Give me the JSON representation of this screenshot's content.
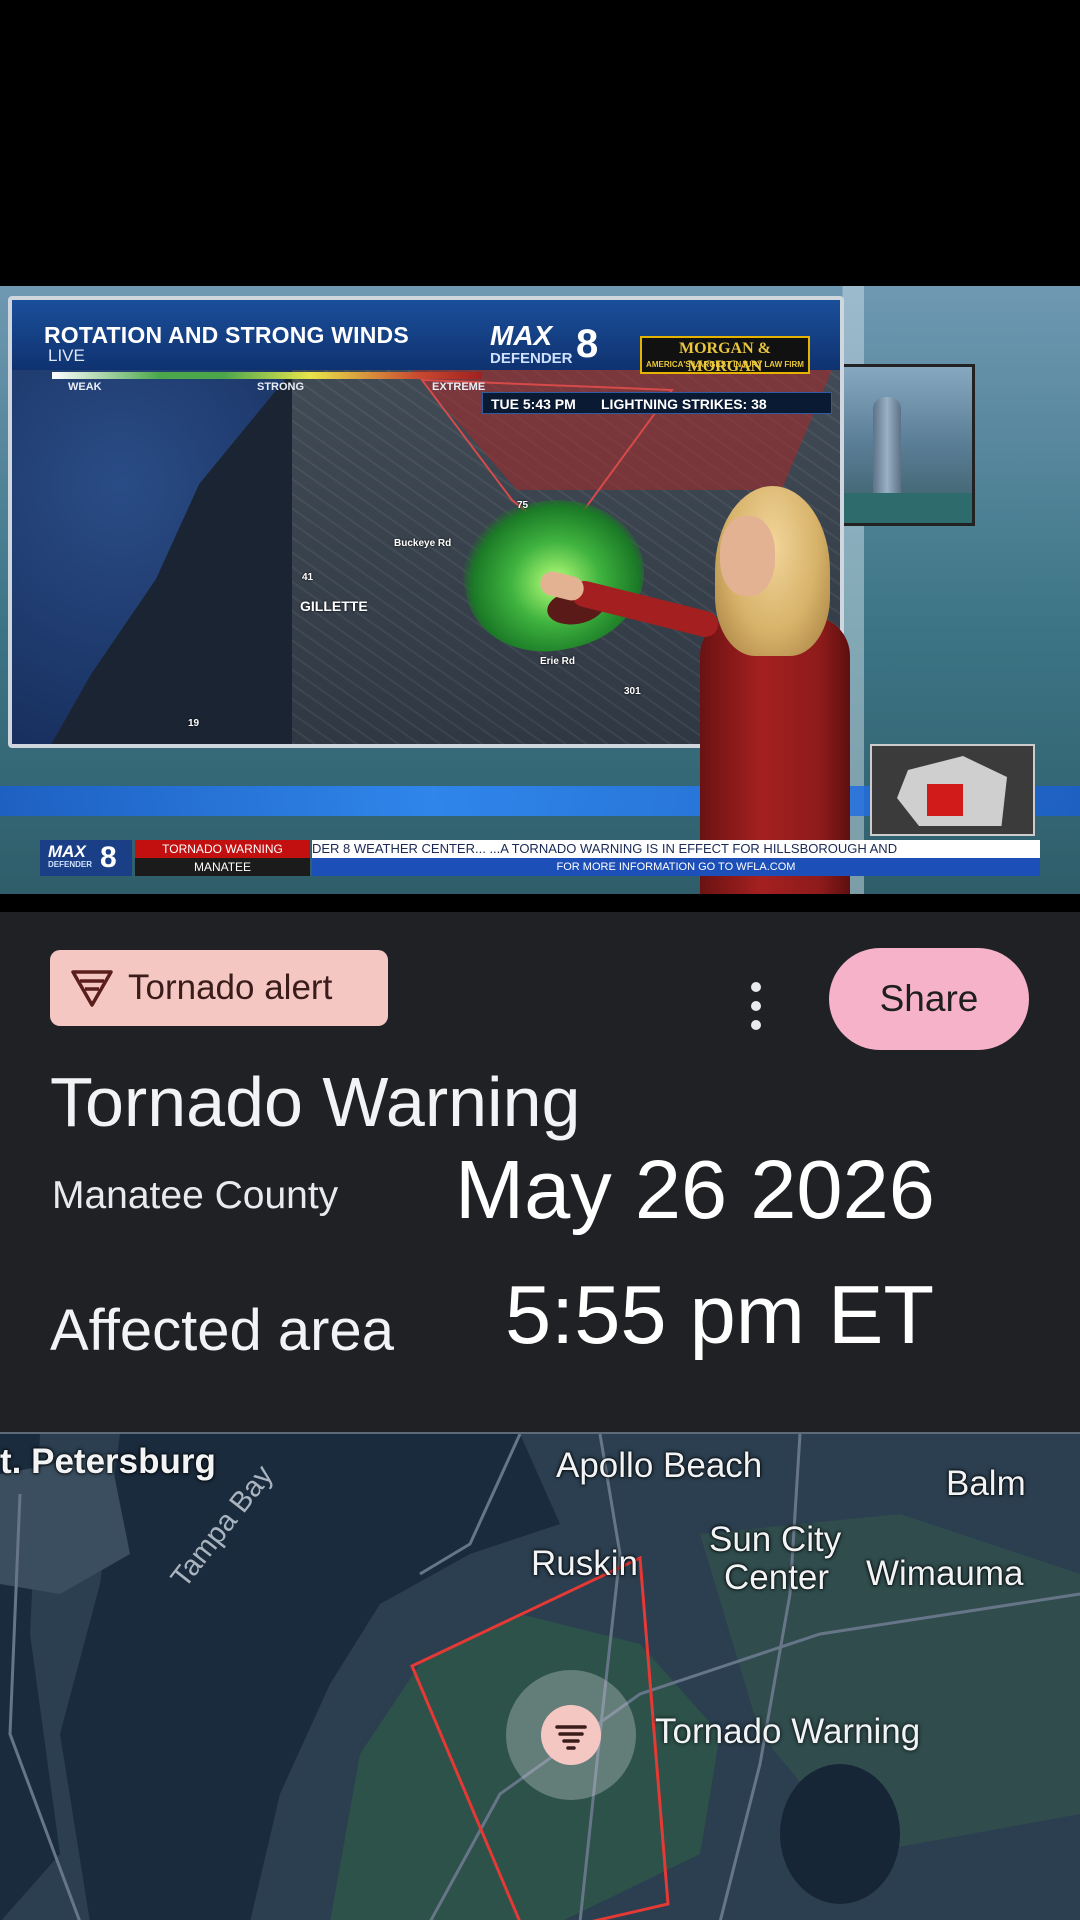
{
  "broadcast": {
    "title": "ROTATION AND STRONG WINDS",
    "live": "LIVE",
    "logo_max": "MAX",
    "logo_defender": "DEFENDER",
    "logo_number": "8",
    "sponsor_name": "MORGAN & MORGAN",
    "sponsor_tagline": "AMERICA'S LARGEST INJURY LAW FIRM",
    "scale_weak": "WEAK",
    "scale_strong": "STRONG",
    "scale_extreme": "EXTREME",
    "time": "TUE 5:43 PM",
    "lightning": "LIGHTNING STRIKES: 38",
    "map_labels": {
      "gillette": "GILLETTE",
      "buckeye": "Buckeye Rd",
      "erie": "Erie Rd",
      "route41": "41",
      "route19": "19",
      "route301": "301",
      "route75": "75"
    },
    "lower_third": {
      "logo_max": "MAX",
      "logo_defender": "DEFENDER",
      "logo_number": "8",
      "warning_top": "TORNADO WARNING",
      "warning_bottom": "MANATEE",
      "ticker": "DER 8 WEATHER CENTER...   ...A TORNADO WARNING IS IN EFFECT FOR HILLSBOROUGH AND",
      "info": "FOR MORE INFORMATION GO TO WFLA.COM"
    }
  },
  "alert": {
    "chip_label": "Tornado alert",
    "share_label": "Share",
    "title": "Tornado Warning",
    "county": "Manatee County",
    "date_overlay": "May 26 2026",
    "affected_label": "Affected area",
    "time_overlay": "5:55 pm ET"
  },
  "map": {
    "cities": {
      "st_petersburg": "t. Petersburg",
      "apollo_beach": "Apollo Beach",
      "balm": "Balm",
      "ruskin": "Ruskin",
      "sun_city_1": "Sun City",
      "sun_city_2": "Center",
      "wimauma": "Wimauma"
    },
    "bay_label": "Tampa Bay",
    "marker_label": "Tornado Warning",
    "polygon_color": "#e53935"
  },
  "colors": {
    "chip_bg": "#f4c7c3",
    "share_bg": "#f5b2c8",
    "panel_bg": "#202124"
  }
}
